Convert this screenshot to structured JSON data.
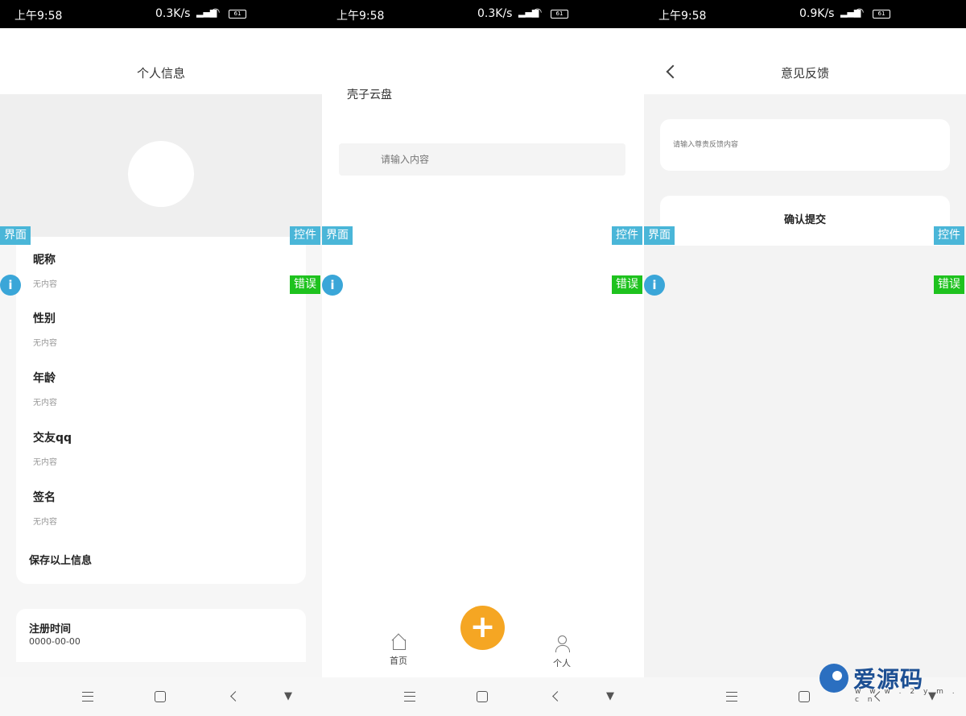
{
  "status_bars": [
    {
      "time": "上午9:58",
      "speed": "0.3K/s",
      "battery": "61"
    },
    {
      "time": "上午9:58",
      "speed": "0.3K/s",
      "battery": "61"
    },
    {
      "time": "上午9:58",
      "speed": "0.9K/s",
      "battery": "61"
    }
  ],
  "overlay": {
    "ui_tag": "界面",
    "widget_tag": "控件",
    "error_tag": "错误",
    "info_glyph": "i"
  },
  "profile": {
    "title": "个人信息",
    "fields": [
      {
        "label": "昵称",
        "value": "无内容"
      },
      {
        "label": "性别",
        "value": "无内容"
      },
      {
        "label": "年龄",
        "value": "无内容"
      },
      {
        "label": "交友qq",
        "value": "无内容"
      },
      {
        "label": "签名",
        "value": "无内容"
      }
    ],
    "save_label": "保存以上信息",
    "register_label": "注册时间",
    "register_value": "0000-00-00"
  },
  "home": {
    "title": "壳子云盘",
    "search_placeholder": "请输入内容",
    "fab_symbol": "+",
    "tab_home": "首页",
    "tab_personal": "个人"
  },
  "feedback": {
    "title": "意见反馈",
    "input_placeholder": "请输入尊贵反馈内容",
    "submit_label": "确认提交"
  },
  "watermark": {
    "text": "爱源码",
    "url": "w w w . 2 y m . c n"
  },
  "colors": {
    "fab": "#f5a623",
    "tag_blue": "#4ab6d8",
    "tag_green": "#1ec21e",
    "info": "#3aa6d8"
  }
}
